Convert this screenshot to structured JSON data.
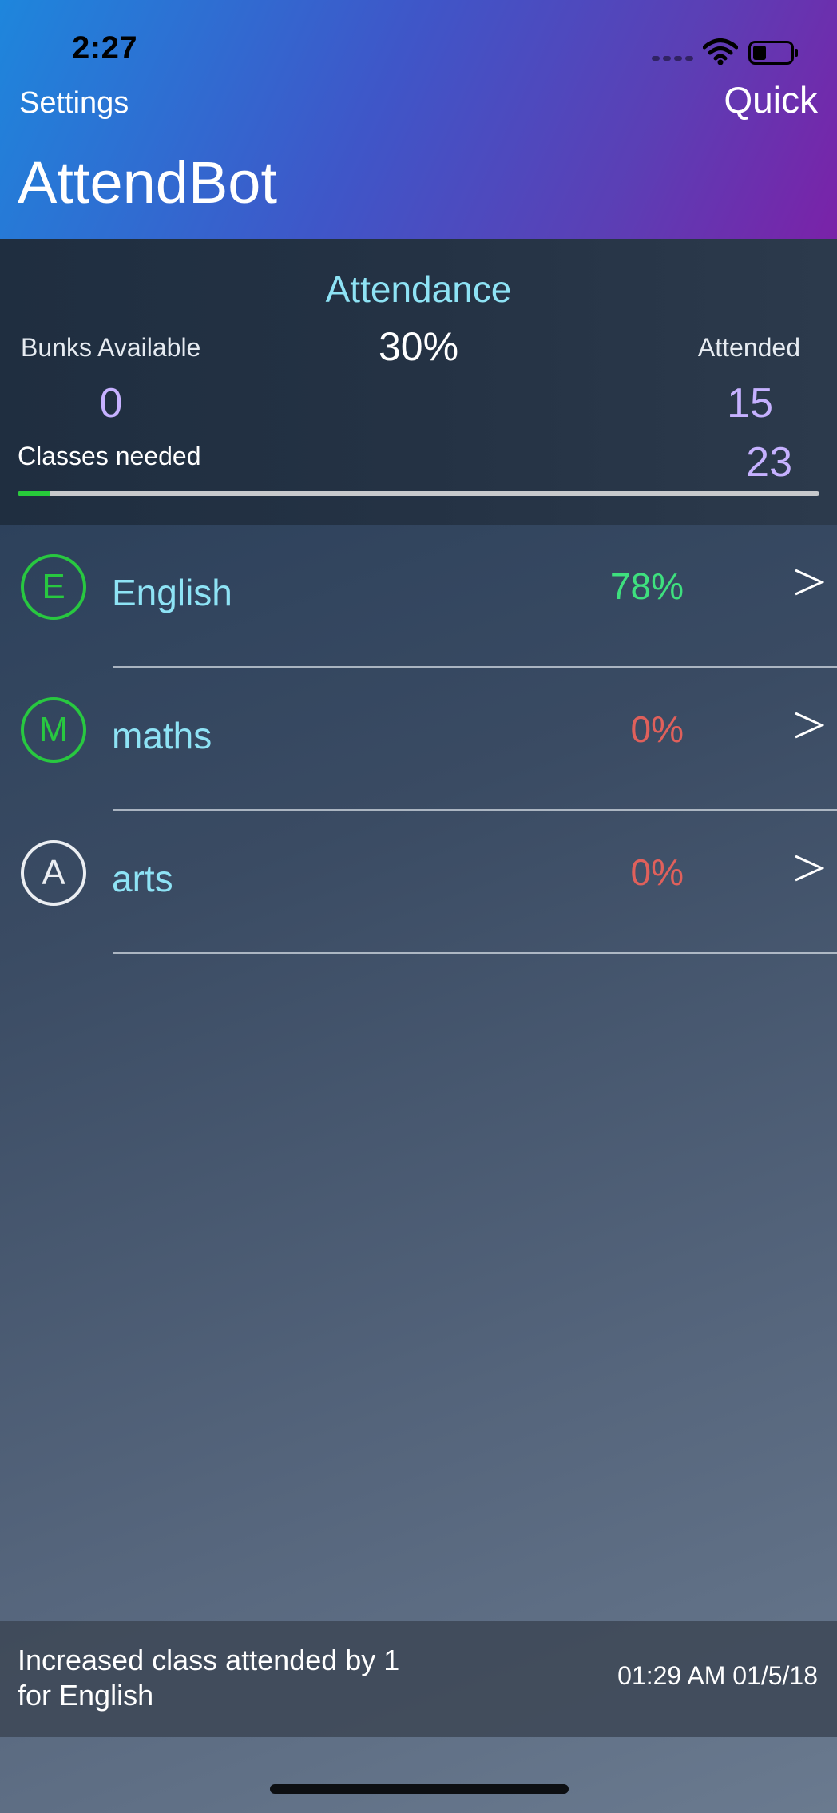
{
  "status_bar": {
    "time": "2:27",
    "battery_level": 0.35,
    "icons": [
      "cellular-signal-icon",
      "wifi-icon",
      "battery-icon"
    ]
  },
  "nav": {
    "left_label": "Settings",
    "right_label": "Quick",
    "title": "AttendBot"
  },
  "summary": {
    "attendance_label": "Attendance",
    "attendance_value": "30%",
    "bunks_label": "Bunks Available",
    "bunks_value": "0",
    "attended_label": "Attended",
    "attended_value": "15",
    "needed_label": "Classes needed",
    "needed_value": "23",
    "progress_fraction": 0.04
  },
  "subjects": [
    {
      "initial": "E",
      "name": "English",
      "percent": "78%",
      "status": "good",
      "avatar_color": "#28c840",
      "icon": "chevron-right-icon"
    },
    {
      "initial": "M",
      "name": "maths",
      "percent": "0%",
      "status": "bad",
      "avatar_color": "#28c840",
      "icon": "chevron-right-icon"
    },
    {
      "initial": "A",
      "name": "arts",
      "percent": "0%",
      "status": "bad",
      "avatar_color": "#ebeef2",
      "icon": "chevron-right-icon"
    }
  ],
  "log": {
    "message_line1": "Increased class attended by 1",
    "message_line2": "for English",
    "timestamp": "01:29 AM 01/5/18"
  },
  "colors": {
    "header_gradient_start": "#1e86dc",
    "header_gradient_end": "#7a22a8",
    "accent_cyan": "#8ee3f5",
    "accent_violet": "#c6b1ff",
    "good_green": "#3ee07e",
    "bad_red": "#e0605b",
    "progress_green": "#27cc3a"
  }
}
